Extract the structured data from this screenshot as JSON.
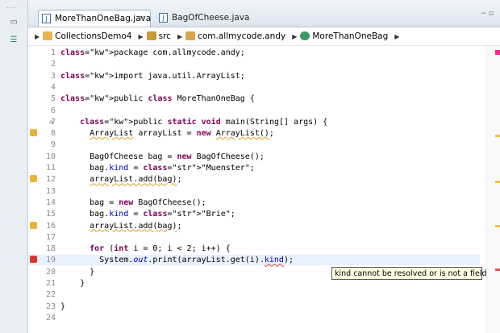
{
  "sidebar": {
    "grip": "....",
    "restore_icon": "restore-icon",
    "hierarchy_icon": "hierarchy-icon"
  },
  "tabs": [
    {
      "label": "MoreThanOneBag.java",
      "close": "✕"
    },
    {
      "label": "BagOfCheese.java"
    }
  ],
  "window_controls": "−  ▫",
  "breadcrumb": [
    "CollectionsDemo4",
    "src",
    "com.allmycode.andy",
    "MoreThanOneBag"
  ],
  "tooltip": "kind cannot be resolved or is not a field",
  "colors": {
    "keyword": "#7f0055",
    "string": "#2a00ff",
    "field": "#0000c0",
    "warning": "#e6b43a",
    "error": "#d23b2f"
  },
  "code_lines": [
    {
      "num": "1",
      "marker": "",
      "text": "package com.allmycode.andy;"
    },
    {
      "num": "2",
      "marker": "",
      "text": ""
    },
    {
      "num": "3",
      "marker": "",
      "text": "import java.util.ArrayList;"
    },
    {
      "num": "4",
      "marker": "",
      "text": ""
    },
    {
      "num": "5",
      "marker": "",
      "text": "public class MoreThanOneBag {"
    },
    {
      "num": "6",
      "marker": "",
      "text": ""
    },
    {
      "num": "7",
      "marker": "fold",
      "text": "    public static void main(String[] args) {"
    },
    {
      "num": "8",
      "marker": "warn",
      "text": "      ArrayList arrayList = new ArrayList();"
    },
    {
      "num": "9",
      "marker": "",
      "text": ""
    },
    {
      "num": "10",
      "marker": "",
      "text": "      BagOfCheese bag = new BagOfCheese();"
    },
    {
      "num": "11",
      "marker": "",
      "text": "      bag.kind = \"Muenster\";"
    },
    {
      "num": "12",
      "marker": "warn",
      "text": "      arrayList.add(bag);"
    },
    {
      "num": "13",
      "marker": "",
      "text": ""
    },
    {
      "num": "14",
      "marker": "",
      "text": "      bag = new BagOfCheese();"
    },
    {
      "num": "15",
      "marker": "",
      "text": "      bag.kind = \"Brie\";"
    },
    {
      "num": "16",
      "marker": "warn",
      "text": "      arrayList.add(bag);"
    },
    {
      "num": "17",
      "marker": "",
      "text": ""
    },
    {
      "num": "18",
      "marker": "",
      "text": "      for (int i = 0; i < 2; i++) {"
    },
    {
      "num": "19",
      "marker": "error",
      "text": "        System.out.print(arrayList.get(i).kind);"
    },
    {
      "num": "20",
      "marker": "",
      "text": "      }"
    },
    {
      "num": "21",
      "marker": "",
      "text": "    }"
    },
    {
      "num": "22",
      "marker": "",
      "text": ""
    },
    {
      "num": "23",
      "marker": "",
      "text": "}"
    },
    {
      "num": "24",
      "marker": "",
      "text": ""
    }
  ]
}
